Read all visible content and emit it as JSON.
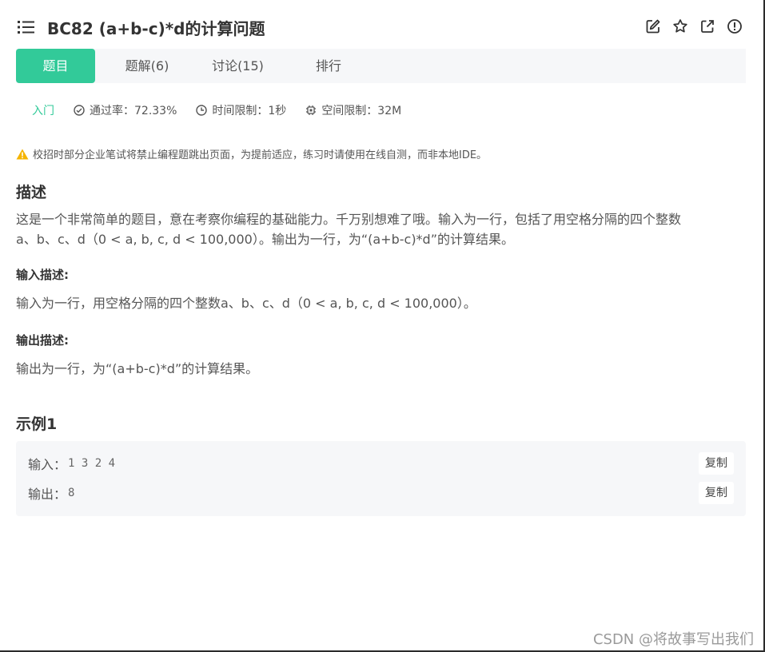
{
  "header": {
    "title": "BC82  (a+b-c)*d的计算问题"
  },
  "tabs": [
    {
      "label": "题目"
    },
    {
      "label": "题解(6)"
    },
    {
      "label": "讨论(15)"
    },
    {
      "label": "排行"
    }
  ],
  "meta": {
    "difficulty": "入门",
    "pass_rate": "通过率：72.33%",
    "time_limit": "时间限制：1秒",
    "space_limit": "空间限制：32M"
  },
  "warning": "校招时部分企业笔试将禁止编程题跳出页面，为提前适应，练习时请使用在线自测，而非本地IDE。",
  "description": {
    "heading": "描述",
    "line1": "这是一个非常简单的题目，意在考察你编程的基础能力。千万别想难了哦。输入为一行，包括了用空格分隔的四个整数",
    "line2": "a、b、c、d（0 < a, b, c, d < 100,000）。输出为一行，为“(a+b-c)*d”的计算结果。"
  },
  "input_desc": {
    "heading": "输入描述:",
    "text": "输入为一行，用空格分隔的四个整数a、b、c、d（0 < a, b, c, d < 100,000）。"
  },
  "output_desc": {
    "heading": "输出描述:",
    "text": "输出为一行，为“(a+b-c)*d”的计算结果。"
  },
  "example": {
    "heading": "示例1",
    "input_label": "输入：",
    "input_value": "1 3 2 4",
    "output_label": "输出：",
    "output_value": "8",
    "copy_label": "复制"
  },
  "watermark": "CSDN @将故事写出我们",
  "colors": {
    "accent": "#32ca99",
    "warning": "#f5b400",
    "tab_bg": "#f6f7f9"
  }
}
